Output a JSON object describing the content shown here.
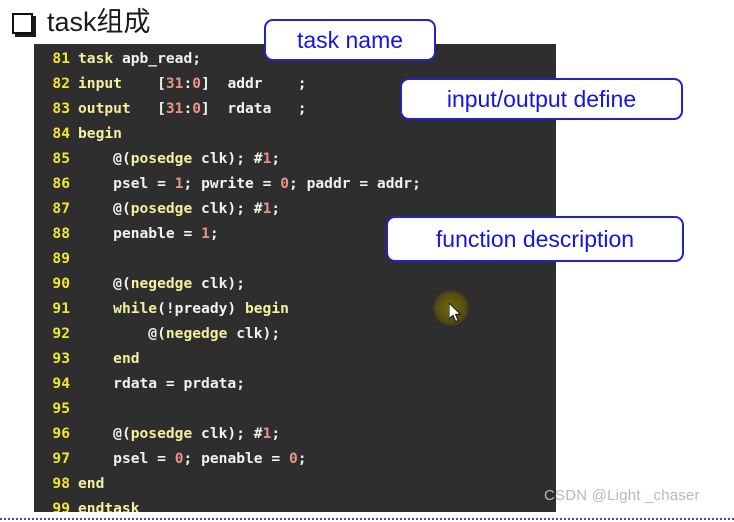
{
  "slide": {
    "bullet_icon": "hollow-square-bullet",
    "title": "task组成"
  },
  "code_panel": {
    "background_color": "#2e2e2e",
    "line_number_color": "#f2e733",
    "keyword_color": "#f3f0a0",
    "identifier_color": "#f2f2f2",
    "number_color": "#ec9287",
    "language": "Verilog",
    "lines": [
      {
        "number": "81",
        "text": "task apb_read;"
      },
      {
        "number": "82",
        "text": "input    [31:0]  addr    ;"
      },
      {
        "number": "83",
        "text": "output   [31:0]  rdata   ;"
      },
      {
        "number": "84",
        "text": "begin"
      },
      {
        "number": "85",
        "text": "    @(posedge clk); #1;"
      },
      {
        "number": "86",
        "text": "    psel = 1; pwrite = 0; paddr = addr;"
      },
      {
        "number": "87",
        "text": "    @(posedge clk); #1;"
      },
      {
        "number": "88",
        "text": "    penable = 1;"
      },
      {
        "number": "89",
        "text": ""
      },
      {
        "number": "90",
        "text": "    @(negedge clk);"
      },
      {
        "number": "91",
        "text": "    while(!pready) begin"
      },
      {
        "number": "92",
        "text": "        @(negedge clk);"
      },
      {
        "number": "93",
        "text": "    end"
      },
      {
        "number": "94",
        "text": "    rdata = prdata;"
      },
      {
        "number": "95",
        "text": ""
      },
      {
        "number": "96",
        "text": "    @(posedge clk); #1;"
      },
      {
        "number": "97",
        "text": "    psel = 0; penable = 0;"
      },
      {
        "number": "98",
        "text": "end"
      },
      {
        "number": "99",
        "text": "endtask"
      }
    ]
  },
  "callouts": [
    {
      "id": "task-name",
      "label": "task name",
      "color": "#1414e6",
      "border_color": "#2222cc"
    },
    {
      "id": "io-define",
      "label": "input/output define",
      "color": "#1414e6",
      "border_color": "#2222cc"
    },
    {
      "id": "func-desc",
      "label": "function description",
      "color": "#1414e6",
      "border_color": "#2222cc"
    }
  ],
  "watermark": {
    "text": "CSDN @Light _chaser",
    "color": "#b9b9b9"
  },
  "cursor": {
    "icon": "mouse-pointer-icon",
    "highlight_color": "#78690a"
  }
}
